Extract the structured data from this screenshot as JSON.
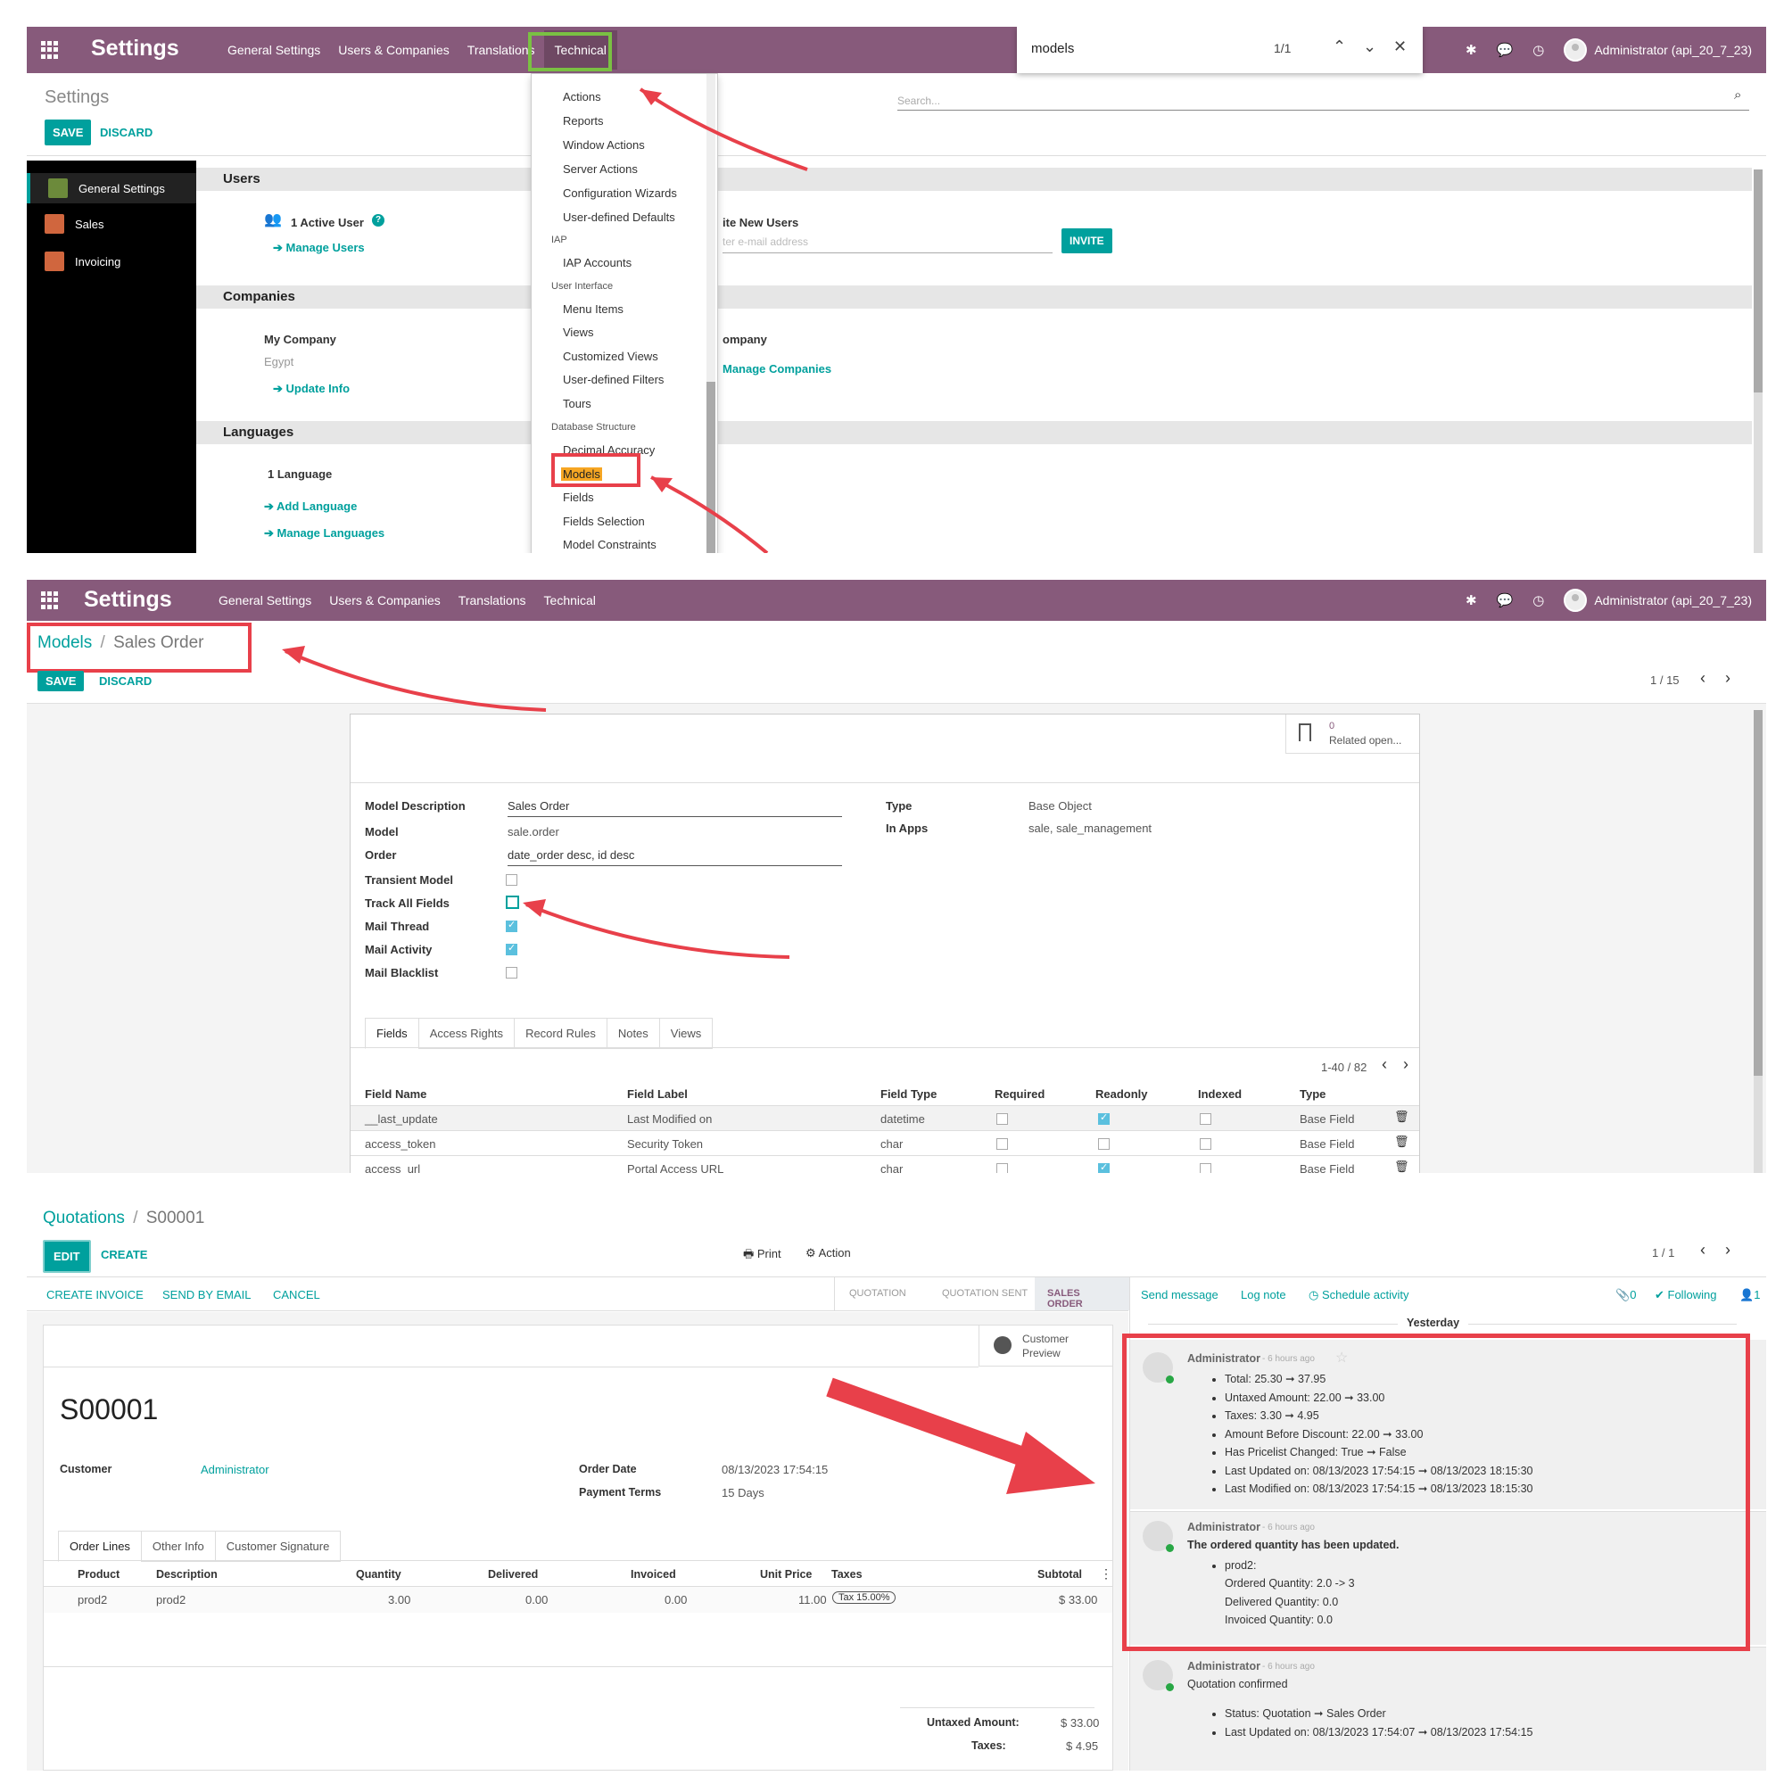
{
  "panel1": {
    "brand": "Settings",
    "menu": [
      "General Settings",
      "Users & Companies",
      "Translations",
      "Technical"
    ],
    "user": "Administrator (api_20_7_23)",
    "find": {
      "query": "models",
      "count": "1/1"
    },
    "breadcrumb": "Settings",
    "save": "SAVE",
    "discard": "DISCARD",
    "search_placeholder": "Search...",
    "sidebar": [
      "General Settings",
      "Sales",
      "Invoicing"
    ],
    "sections": {
      "users": "Users",
      "active_users": "1 Active User",
      "manage_users": "Manage Users",
      "invite_label": "ite New Users",
      "email_placeholder": "ter e-mail address",
      "invite": "INVITE",
      "companies": "Companies",
      "my_company": "My Company",
      "country": "Egypt",
      "update_info": "Update Info",
      "company_label": "ompany",
      "manage_companies": "Manage Companies",
      "languages": "Languages",
      "one_language": "1 Language",
      "add_language": "Add Language",
      "manage_languages": "Manage Languages"
    },
    "dropdown": {
      "items_top": [
        "Actions",
        "Reports",
        "Window Actions",
        "Server Actions",
        "Configuration Wizards",
        "User-defined Defaults"
      ],
      "iap_header": "IAP",
      "iap_items": [
        "IAP Accounts"
      ],
      "ui_header": "User Interface",
      "ui_items": [
        "Menu Items",
        "Views",
        "Customized Views",
        "User-defined Filters",
        "Tours"
      ],
      "db_header": "Database Structure",
      "db_items": [
        "Decimal Accuracy",
        "Models",
        "Fields",
        "Fields Selection",
        "Model Constraints"
      ]
    }
  },
  "panel2": {
    "brand": "Settings",
    "menu": [
      "General Settings",
      "Users & Companies",
      "Translations",
      "Technical"
    ],
    "user": "Administrator (api_20_7_23)",
    "breadcrumb_root": "Models",
    "breadcrumb_sep": "/",
    "breadcrumb_current": "Sales Order",
    "save": "SAVE",
    "discard": "DISCARD",
    "pager": "1 / 15",
    "related_count": "0",
    "related_label": "Related open...",
    "fields": {
      "model_description_label": "Model Description",
      "model_description": "Sales Order",
      "model_label": "Model",
      "model": "sale.order",
      "order_label": "Order",
      "order": "date_order desc, id desc",
      "transient_label": "Transient Model",
      "track_label": "Track All Fields",
      "mail_thread_label": "Mail Thread",
      "mail_activity_label": "Mail Activity",
      "mail_blacklist_label": "Mail Blacklist",
      "type_label": "Type",
      "type": "Base Object",
      "in_apps_label": "In Apps",
      "in_apps": "sale, sale_management"
    },
    "tabs": [
      "Fields",
      "Access Rights",
      "Record Rules",
      "Notes",
      "Views"
    ],
    "list_pager": "1-40 / 82",
    "columns": [
      "Field Name",
      "Field Label",
      "Field Type",
      "Required",
      "Readonly",
      "Indexed",
      "Type"
    ],
    "rows": [
      {
        "name": "__last_update",
        "label": "Last Modified on",
        "ftype": "datetime",
        "required": false,
        "readonly": true,
        "indexed": false,
        "type": "Base Field"
      },
      {
        "name": "access_token",
        "label": "Security Token",
        "ftype": "char",
        "required": false,
        "readonly": false,
        "indexed": false,
        "type": "Base Field"
      },
      {
        "name": "access_url",
        "label": "Portal Access URL",
        "ftype": "char",
        "required": false,
        "readonly": true,
        "indexed": false,
        "type": "Base Field"
      }
    ]
  },
  "panel3": {
    "breadcrumb_root": "Quotations",
    "breadcrumb_sep": "/",
    "breadcrumb_current": "S00001",
    "edit": "EDIT",
    "create": "CREATE",
    "print": "Print",
    "action": "Action",
    "pager": "1 / 1",
    "header_buttons": [
      "CREATE INVOICE",
      "SEND BY EMAIL",
      "CANCEL"
    ],
    "statusbar": [
      "QUOTATION",
      "QUOTATION SENT",
      "SALES ORDER"
    ],
    "customer_preview": [
      "Customer",
      "Preview"
    ],
    "title": "S00001",
    "customer_label": "Customer",
    "customer": "Administrator",
    "order_date_label": "Order Date",
    "order_date": "08/13/2023 17:54:15",
    "payment_terms_label": "Payment Terms",
    "payment_terms": "15 Days",
    "tabs": [
      "Order Lines",
      "Other Info",
      "Customer Signature"
    ],
    "columns": [
      "Product",
      "Description",
      "Quantity",
      "Delivered",
      "Invoiced",
      "Unit Price",
      "Taxes",
      "Subtotal"
    ],
    "line": {
      "product": "prod2",
      "description": "prod2",
      "quantity": "3.00",
      "delivered": "0.00",
      "invoiced": "0.00",
      "unit_price": "11.00",
      "taxes": "Tax 15.00%",
      "subtotal": "$ 33.00"
    },
    "untaxed_label": "Untaxed Amount:",
    "untaxed": "$ 33.00",
    "taxes_label": "Taxes:",
    "taxes": "$ 4.95",
    "chatter": {
      "send_message": "Send message",
      "log_note": "Log note",
      "schedule": "Schedule activity",
      "attachments": "0",
      "following": "Following",
      "followers": "1",
      "day": "Yesterday",
      "messages": [
        {
          "author": "Administrator",
          "time": "- 6 hours ago",
          "body": "",
          "items": [
            "Total: 25.30 ➞ 37.95",
            "Untaxed Amount: 22.00 ➞ 33.00",
            "Taxes: 3.30 ➞ 4.95",
            "Amount Before Discount: 22.00 ➞ 33.00",
            "Has Pricelist Changed: True ➞ False",
            "Last Updated on: 08/13/2023 17:54:15 ➞ 08/13/2023 18:15:30",
            "Last Modified on: 08/13/2023 17:54:15 ➞ 08/13/2023 18:15:30"
          ]
        },
        {
          "author": "Administrator",
          "time": "- 6 hours ago",
          "body": "The ordered quantity has been updated.",
          "items": [
            "prod2:"
          ],
          "sub": [
            "Ordered Quantity: 2.0 -> 3",
            "Delivered Quantity: 0.0",
            "Invoiced Quantity: 0.0"
          ]
        },
        {
          "author": "Administrator",
          "time": "- 6 hours ago",
          "body": "Quotation confirmed",
          "items": [
            "Status: Quotation ➞ Sales Order",
            "Last Updated on: 08/13/2023 17:54:07 ➞ 08/13/2023 17:54:15"
          ]
        }
      ]
    }
  },
  "colors": {
    "brand_purple": "#875a7b",
    "accent_teal": "#00a09d",
    "annotation_red": "#e8404a",
    "annotation_green": "#7ac043",
    "highlight_orange": "#f6a623"
  }
}
